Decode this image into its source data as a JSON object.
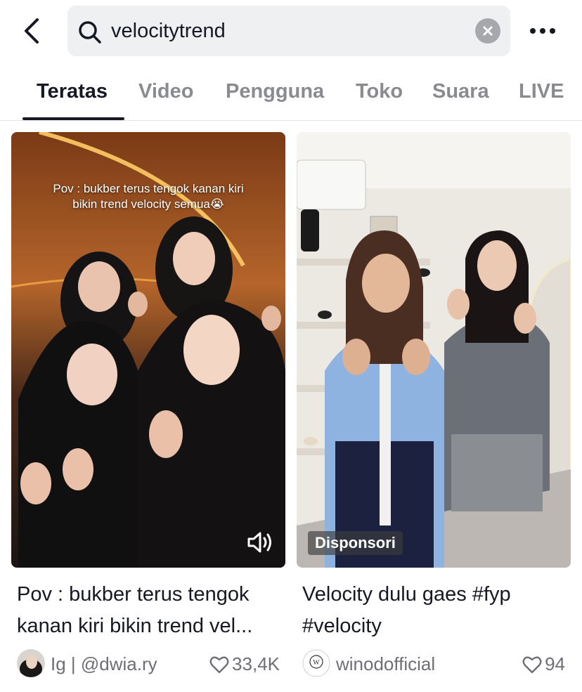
{
  "search": {
    "query": "velocitytrend"
  },
  "icons": {
    "back": "chevron-left-icon",
    "search": "search-icon",
    "clear": "close-icon",
    "more": "more-horizontal-icon",
    "volume": "volume-icon",
    "like": "heart-icon"
  },
  "tabs": [
    {
      "label": "Teratas",
      "active": true
    },
    {
      "label": "Video",
      "active": false
    },
    {
      "label": "Pengguna",
      "active": false
    },
    {
      "label": "Toko",
      "active": false
    },
    {
      "label": "Suara",
      "active": false
    },
    {
      "label": "LIVE",
      "active": false
    }
  ],
  "results": [
    {
      "overlay_text": [
        "Pov : bukber terus tengok kanan kiri",
        "bikin trend velocity semua😭"
      ],
      "caption_lines": [
        "Pov : bukber terus tengok",
        "kanan kiri bikin trend vel..."
      ],
      "username": "Ig | @dwia.ry",
      "likes": "33,4K"
    },
    {
      "badge": "Disponsori",
      "caption_lines": [
        "Velocity dulu gaes #fyp",
        "#velocity"
      ],
      "username": "winodofficial",
      "likes": "94",
      "avatar_text": "W"
    }
  ],
  "colors": {
    "text_primary": "#161823",
    "text_secondary": "#6e6f76",
    "tab_inactive": "#8a8b91",
    "search_bg": "#eff0f2"
  }
}
